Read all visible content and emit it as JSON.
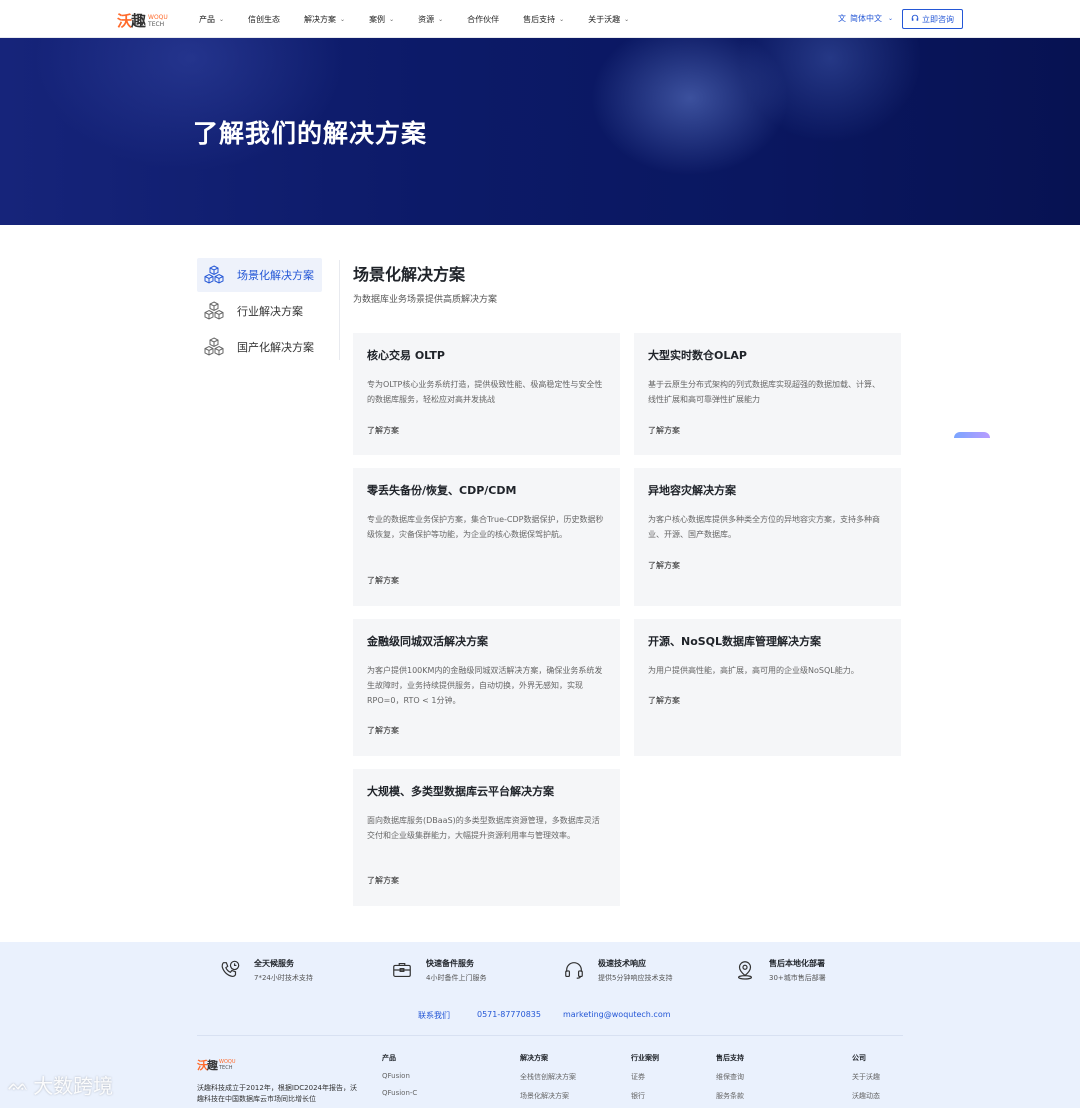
{
  "header": {
    "logo": {
      "cn_a": "沃",
      "cn_b": "趣",
      "en_a": "WOQU",
      "en_b": "TECH"
    },
    "nav": [
      {
        "label": "产品",
        "dropdown": true
      },
      {
        "label": "信创生态",
        "dropdown": false
      },
      {
        "label": "解决方案",
        "dropdown": true
      },
      {
        "label": "案例",
        "dropdown": true
      },
      {
        "label": "资源",
        "dropdown": true
      },
      {
        "label": "合作伙伴",
        "dropdown": false
      },
      {
        "label": "售后支持",
        "dropdown": true
      },
      {
        "label": "关于沃趣",
        "dropdown": true
      }
    ],
    "language": "简体中文",
    "consult_button": "立即咨询"
  },
  "hero": {
    "title": "了解我们的解决方案"
  },
  "sidebar": {
    "items": [
      {
        "label": "场景化解决方案",
        "active": true
      },
      {
        "label": "行业解决方案",
        "active": false
      },
      {
        "label": "国产化解决方案",
        "active": false
      }
    ]
  },
  "main": {
    "title": "场景化解决方案",
    "subtitle": "为数据库业务场景提供高质解决方案",
    "link_label": "了解方案",
    "cards": [
      {
        "title": "核心交易 OLTP",
        "desc": "专为OLTP核心业务系统打造，提供极致性能、极高稳定性与安全性的数据库服务，轻松应对高并发挑战"
      },
      {
        "title": "大型实时数仓OLAP",
        "desc": "基于云原生分布式架构的列式数据库实现超强的数据加载、计算、线性扩展和高可靠弹性扩展能力"
      },
      {
        "title": "零丢失备份/恢复、CDP/CDM",
        "desc": "专业的数据库业务保护方案，集合True-CDP数据保护，历史数据秒级恢复，灾备保护等功能，为企业的核心数据保驾护航。"
      },
      {
        "title": "异地容灾解决方案",
        "desc": "为客户核心数据库提供多种类全方位的异地容灾方案，支持多种商业、开源、国产数据库。"
      },
      {
        "title": "金融级同城双活解决方案",
        "desc": "为客户提供100KM内的金融级同城双活解决方案，确保业务系统发生故障时，业务持续提供服务，自动切换，外界无感知，实现RPO=0，RTO < 1分钟。"
      },
      {
        "title": "开源、NoSQL数据库管理解决方案",
        "desc": "为用户提供高性能，高扩展，高可用的企业级NoSQL能力。"
      },
      {
        "title": "大规模、多类型数据库云平台解决方案",
        "desc": "面向数据库服务(DBaaS)的多类型数据库资源管理，多数据库灵活交付和企业级集群能力，大幅提升资源利用率与管理效率。"
      }
    ]
  },
  "footer": {
    "services": [
      {
        "icon": "phone-clock-icon",
        "title": "全天候服务",
        "desc": "7*24小时技术支持"
      },
      {
        "icon": "toolbox-icon",
        "title": "快速备件服务",
        "desc": "4小时备件上门服务"
      },
      {
        "icon": "headset-icon",
        "title": "极速技术响应",
        "desc": "提供5分钟响应技术支持"
      },
      {
        "icon": "location-pin-icon",
        "title": "售后本地化部署",
        "desc": "30+城市售后部署"
      }
    ],
    "contact": {
      "label": "联系我们",
      "phone": "0571-87770835",
      "email": "marketing@woqutech.com"
    },
    "about": "沃趣科技成立于2012年，根据IDC2024年报告，沃趣科技在中国数据库云市场同比增长位",
    "columns": [
      {
        "heading": "产品",
        "items": [
          "QFusion",
          "QFusion-C"
        ]
      },
      {
        "heading": "解决方案",
        "items": [
          "全栈信创解决方案",
          "场景化解决方案"
        ]
      },
      {
        "heading": "行业案例",
        "items": [
          "证券",
          "银行"
        ]
      },
      {
        "heading": "售后支持",
        "items": [
          "维保查询",
          "服务条款"
        ]
      },
      {
        "heading": "公司",
        "items": [
          "关于沃趣",
          "沃趣动态"
        ]
      }
    ]
  },
  "watermark": "大数跨境",
  "colors": {
    "brand_blue": "#2457d6",
    "logo_orange": "#ff6a2b",
    "hero_navy": "#0c1a68",
    "footer_bg": "#eaf1fd"
  }
}
